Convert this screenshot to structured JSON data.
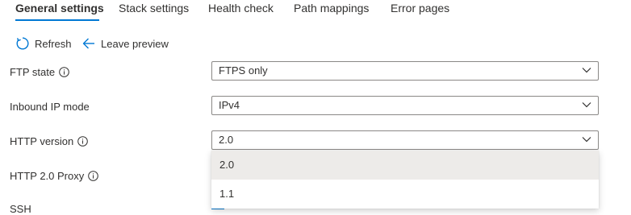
{
  "tabs": [
    {
      "label": "General settings",
      "active": true
    },
    {
      "label": "Stack settings",
      "active": false
    },
    {
      "label": "Health check",
      "active": false
    },
    {
      "label": "Path mappings",
      "active": false
    },
    {
      "label": "Error pages",
      "active": false
    }
  ],
  "toolbar": {
    "refresh_label": "Refresh",
    "leave_preview_label": "Leave preview"
  },
  "fields": {
    "ftp_state": {
      "label": "FTP state",
      "value": "FTPS only"
    },
    "inbound_ip": {
      "label": "Inbound IP mode",
      "value": "IPv4"
    },
    "http_version": {
      "label": "HTTP version",
      "value": "2.0"
    },
    "http2_proxy": {
      "label": "HTTP 2.0 Proxy"
    },
    "ssh": {
      "label": "SSH"
    }
  },
  "http_version_options": [
    {
      "label": "2.0",
      "selected": true
    },
    {
      "label": "1.1",
      "selected": false
    }
  ],
  "colors": {
    "accent": "#0078d4",
    "text": "#323130",
    "border": "#8a8886",
    "selected_option_bg": "#edebe9"
  },
  "icons": {
    "refresh": "refresh-icon",
    "leave_preview": "arrow-left-icon",
    "info": "info-icon",
    "dropdown": "chevron-down-icon"
  }
}
